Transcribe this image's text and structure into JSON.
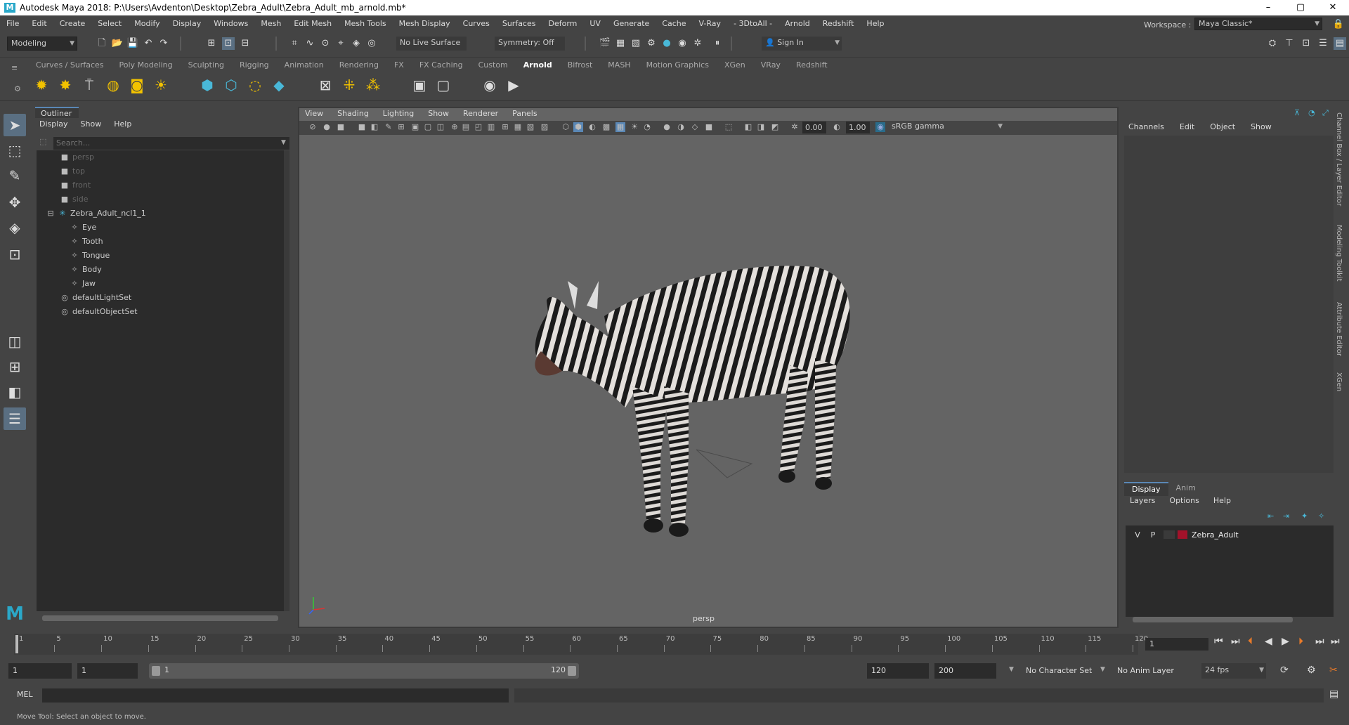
{
  "window": {
    "title": "Autodesk Maya 2018: P:\\Users\\Avdenton\\Desktop\\Zebra_Adult\\Zebra_Adult_mb_arnold.mb*",
    "logo": "M",
    "minimize": "–",
    "maximize": "▢",
    "close": "✕"
  },
  "menubar": [
    "File",
    "Edit",
    "Create",
    "Select",
    "Modify",
    "Display",
    "Windows",
    "Mesh",
    "Edit Mesh",
    "Mesh Tools",
    "Mesh Display",
    "Curves",
    "Surfaces",
    "Deform",
    "UV",
    "Generate",
    "Cache",
    "V-Ray",
    "- 3DtoAll -",
    "Arnold",
    "Redshift",
    "Help"
  ],
  "workspace": {
    "label": "Workspace :",
    "value": "Maya Classic*"
  },
  "status": {
    "mode": "Modeling",
    "live_surface": "No Live Surface",
    "symmetry": "Symmetry: Off",
    "sign_in": "Sign In"
  },
  "shelf_tabs": [
    "Curves / Surfaces",
    "Poly Modeling",
    "Sculpting",
    "Rigging",
    "Animation",
    "Rendering",
    "FX",
    "FX Caching",
    "Custom",
    "Arnold",
    "Bifrost",
    "MASH",
    "Motion Graphics",
    "XGen",
    "VRay",
    "Redshift"
  ],
  "shelf_active": "Arnold",
  "outliner": {
    "title": "Outliner",
    "menu": [
      "Display",
      "Show",
      "Help"
    ],
    "search_placeholder": "Search...",
    "items": [
      {
        "label": "persp",
        "icon": "camera-icon",
        "dim": true
      },
      {
        "label": "top",
        "icon": "camera-icon",
        "dim": true
      },
      {
        "label": "front",
        "icon": "camera-icon",
        "dim": true
      },
      {
        "label": "side",
        "icon": "camera-icon",
        "dim": true
      },
      {
        "label": "Zebra_Adult_ncl1_1",
        "icon": "joint-icon",
        "dim": false
      },
      {
        "label": "Eye",
        "icon": "mesh-icon",
        "dim": false
      },
      {
        "label": "Tooth",
        "icon": "mesh-icon",
        "dim": false
      },
      {
        "label": "Tongue",
        "icon": "mesh-icon",
        "dim": false
      },
      {
        "label": "Body",
        "icon": "mesh-icon",
        "dim": false
      },
      {
        "label": "Jaw",
        "icon": "mesh-icon",
        "dim": false
      },
      {
        "label": "defaultLightSet",
        "icon": "set-icon",
        "dim": false
      },
      {
        "label": "defaultObjectSet",
        "icon": "set-icon",
        "dim": false
      }
    ]
  },
  "viewport": {
    "menu": [
      "View",
      "Shading",
      "Lighting",
      "Show",
      "Renderer",
      "Panels"
    ],
    "exposure": "0.00",
    "gamma": "1.00",
    "color_space": "sRGB gamma",
    "camera_label": "persp"
  },
  "channel_box": {
    "menu": [
      "Channels",
      "Edit",
      "Object",
      "Show"
    ]
  },
  "layer_editor": {
    "tabs": [
      "Display",
      "Anim"
    ],
    "active_tab": "Display",
    "menu": [
      "Layers",
      "Options",
      "Help"
    ],
    "layers": [
      {
        "v": "V",
        "p": "P",
        "name": "Zebra_Adult",
        "color": "#a3122a"
      }
    ]
  },
  "side_tabs": [
    "Channel Box / Layer Editor",
    "Modeling Toolkit",
    "Attribute Editor",
    "XGen"
  ],
  "timeline": {
    "ticks": [
      "1",
      "5",
      "10",
      "15",
      "20",
      "25",
      "30",
      "35",
      "40",
      "45",
      "50",
      "55",
      "60",
      "65",
      "70",
      "75",
      "80",
      "85",
      "90",
      "95",
      "100",
      "105",
      "110",
      "115",
      "120"
    ],
    "current_frame": "1"
  },
  "range": {
    "start": "1",
    "playback_start": "1",
    "slider_start": "1",
    "slider_end": "120",
    "playback_end": "120",
    "end": "200",
    "character_set": "No Character Set",
    "anim_layer": "No Anim Layer",
    "fps": "24 fps"
  },
  "command": {
    "label": "MEL"
  },
  "help_line": "Move Tool: Select an object to move."
}
